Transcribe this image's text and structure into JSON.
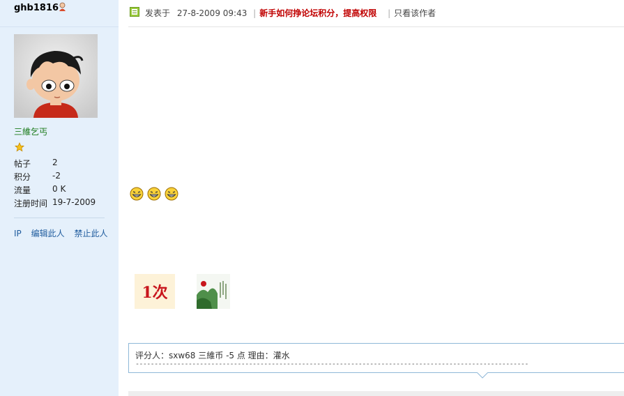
{
  "user": {
    "name": "ghb1816",
    "title": "三維乞丐",
    "stats": [
      {
        "label": "帖子",
        "value": "2"
      },
      {
        "label": "积分",
        "value": "-2"
      },
      {
        "label": "流量",
        "value": "0 K"
      },
      {
        "label": "注册时间",
        "value": "19-7-2009"
      }
    ],
    "actions": {
      "ip": "IP",
      "edit": "编辑此人",
      "ban": "禁止此人"
    }
  },
  "post": {
    "posted_label": "发表于",
    "datetime": "27-8-2009 09:43",
    "promo_link": "新手如何挣论坛积分，提高权限",
    "author_only": "只看该作者",
    "rate_badge": "1次"
  },
  "rating": {
    "text": "评分人：sxw68 三維币  -5 点  理由：灌水",
    "dashes": "--------------------------------------------------------------------------------------------------------"
  },
  "colors": {
    "sidebar_bg": "#e5f0fb",
    "promo": "#c00000",
    "title": "#1a7a1a"
  }
}
